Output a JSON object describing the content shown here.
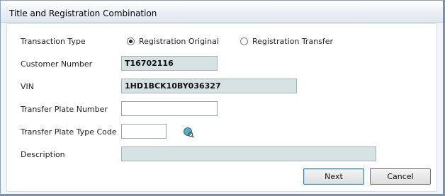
{
  "dialog": {
    "title": "Title and Registration Combination"
  },
  "form": {
    "transaction_type": {
      "label": "Transaction Type",
      "options": [
        {
          "label": "Registration Original",
          "selected": true
        },
        {
          "label": "Registration Transfer",
          "selected": false
        }
      ]
    },
    "customer_number": {
      "label": "Customer Number",
      "value": "T16702116"
    },
    "vin": {
      "label": "VIN",
      "value": "1HD1BCK10BY036327"
    },
    "transfer_plate_number": {
      "label": "Transfer Plate Number",
      "value": ""
    },
    "transfer_plate_type_code": {
      "label": "Transfer Plate Type Code",
      "value": "",
      "lookup_icon": "globe-search-icon"
    },
    "description": {
      "label": "Description",
      "value": ""
    }
  },
  "buttons": {
    "next": "Next",
    "cancel": "Cancel"
  }
}
